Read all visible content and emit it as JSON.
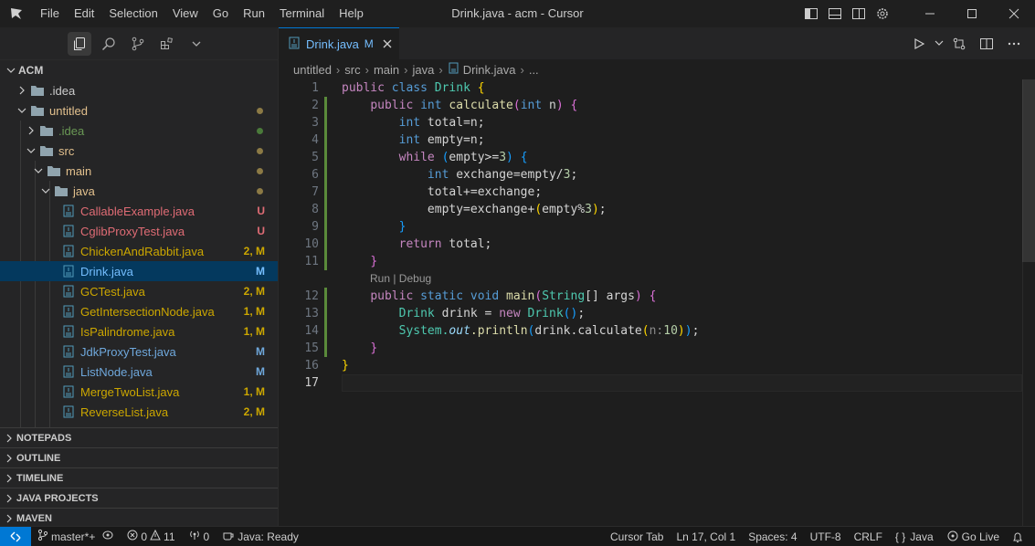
{
  "titlebar": {
    "menu": [
      "File",
      "Edit",
      "Selection",
      "View",
      "Go",
      "Run",
      "Terminal",
      "Help"
    ],
    "window_title": "Drink.java - acm - Cursor",
    "icons": [
      "toggle-primary-sidebar-icon",
      "toggle-panel-icon",
      "toggle-secondary-sidebar-icon",
      "settings-gear-icon"
    ]
  },
  "sidebar": {
    "activity_icons": [
      "explorer-icon",
      "search-icon",
      "source-control-icon",
      "extensions-icon",
      "chevron-down-icon"
    ],
    "tree": [
      {
        "label": "ACM",
        "kind": "root"
      },
      {
        "label": ".idea",
        "kind": "folder"
      },
      {
        "label": "untitled",
        "kind": "folder-open"
      },
      {
        "label": ".idea",
        "kind": "folder"
      },
      {
        "label": "src",
        "kind": "folder-open"
      },
      {
        "label": "main",
        "kind": "folder-open"
      },
      {
        "label": "java",
        "kind": "folder-open"
      },
      {
        "label": "CallableExample.java",
        "badge": "U"
      },
      {
        "label": "CglibProxyTest.java",
        "badge": "U"
      },
      {
        "label": "ChickenAndRabbit.java",
        "badge": "2, M"
      },
      {
        "label": "Drink.java",
        "badge": "M"
      },
      {
        "label": "GCTest.java",
        "badge": "2, M"
      },
      {
        "label": "GetIntersectionNode.java",
        "badge": "1, M"
      },
      {
        "label": "IsPalindrome.java",
        "badge": "1, M"
      },
      {
        "label": "JdkProxyTest.java",
        "badge": "M"
      },
      {
        "label": "ListNode.java",
        "badge": "M"
      },
      {
        "label": "MergeTwoList.java",
        "badge": "1, M"
      },
      {
        "label": "ReverseList.java",
        "badge": "2, M"
      }
    ],
    "sections": [
      "NOTEPADS",
      "OUTLINE",
      "TIMELINE",
      "JAVA PROJECTS",
      "MAVEN"
    ]
  },
  "editor": {
    "tab": {
      "label": "Drink.java",
      "modified": "M"
    },
    "breadcrumb": [
      "untitled",
      "src",
      "main",
      "java",
      "Drink.java",
      "..."
    ],
    "codelens": "Run | Debug",
    "line_numbers": [
      "1",
      "2",
      "3",
      "4",
      "5",
      "6",
      "7",
      "8",
      "9",
      "10",
      "11",
      "12",
      "13",
      "14",
      "15",
      "16",
      "17"
    ],
    "code": {
      "l1": {
        "kw": "public",
        "ty": "class",
        "name": "Drink",
        "br": "{"
      },
      "l2": {
        "kw": "public",
        "ty": "int",
        "fn": "calculate",
        "p1": "(",
        "pty": "int",
        "pn": " n",
        "p2": ")",
        "br": "{"
      },
      "l3": {
        "ty": "int",
        "rest": " total=n;"
      },
      "l4": {
        "ty": "int",
        "rest": " empty=n;"
      },
      "l5": {
        "kw": "while",
        "p1": "(",
        "mid": "empty>=",
        "num": "3",
        "p2": ")",
        "br": "{"
      },
      "l6": {
        "ty": "int",
        "mid": " exchange=empty/",
        "num": "3",
        "end": ";"
      },
      "l7": {
        "text": "total+=exchange;"
      },
      "l8": {
        "a": "empty=exchange+",
        "p1": "(",
        "b": "empty%",
        "num": "3",
        "p2": ")",
        "end": ";"
      },
      "l9": {
        "br": "}"
      },
      "l10": {
        "kw": "return",
        "rest": " total;"
      },
      "l11": {
        "br": "}"
      },
      "l12": {
        "kw": "public",
        "ty": "static",
        "ty2": "void",
        "fn": "main",
        "p1": "(",
        "cls": "String",
        "arr": "[]",
        "pn": " args",
        "p2": ")",
        "br": "{"
      },
      "l13": {
        "cls": "Drink",
        "mid": " drink = ",
        "kw": "new",
        "cls2": "Drink",
        "p": "()",
        "end": ";"
      },
      "l14": {
        "a": "System.",
        "it": "out",
        "b": ".println",
        "p1": "(",
        "c": "drink.calculate",
        "p2": "(",
        "hint": "n:",
        "num": "10",
        "p3": ")",
        "p4": ")",
        "end": ";"
      },
      "l15": {
        "br": "}"
      },
      "l16": {
        "br": "}"
      }
    }
  },
  "statusbar": {
    "branch": "master*+",
    "errors": "0",
    "warnings": "11",
    "ports": "0",
    "java_status": "Java: Ready",
    "cursor_tab": "Cursor Tab",
    "position": "Ln 17, Col 1",
    "spaces": "Spaces: 4",
    "encoding": "UTF-8",
    "eol": "CRLF",
    "language": "Java",
    "golive": "Go Live"
  },
  "colors": {
    "accent": "#0078d4",
    "untracked": "#e06c75",
    "modified": "#e2c08d",
    "selected_row": "#04395e"
  }
}
